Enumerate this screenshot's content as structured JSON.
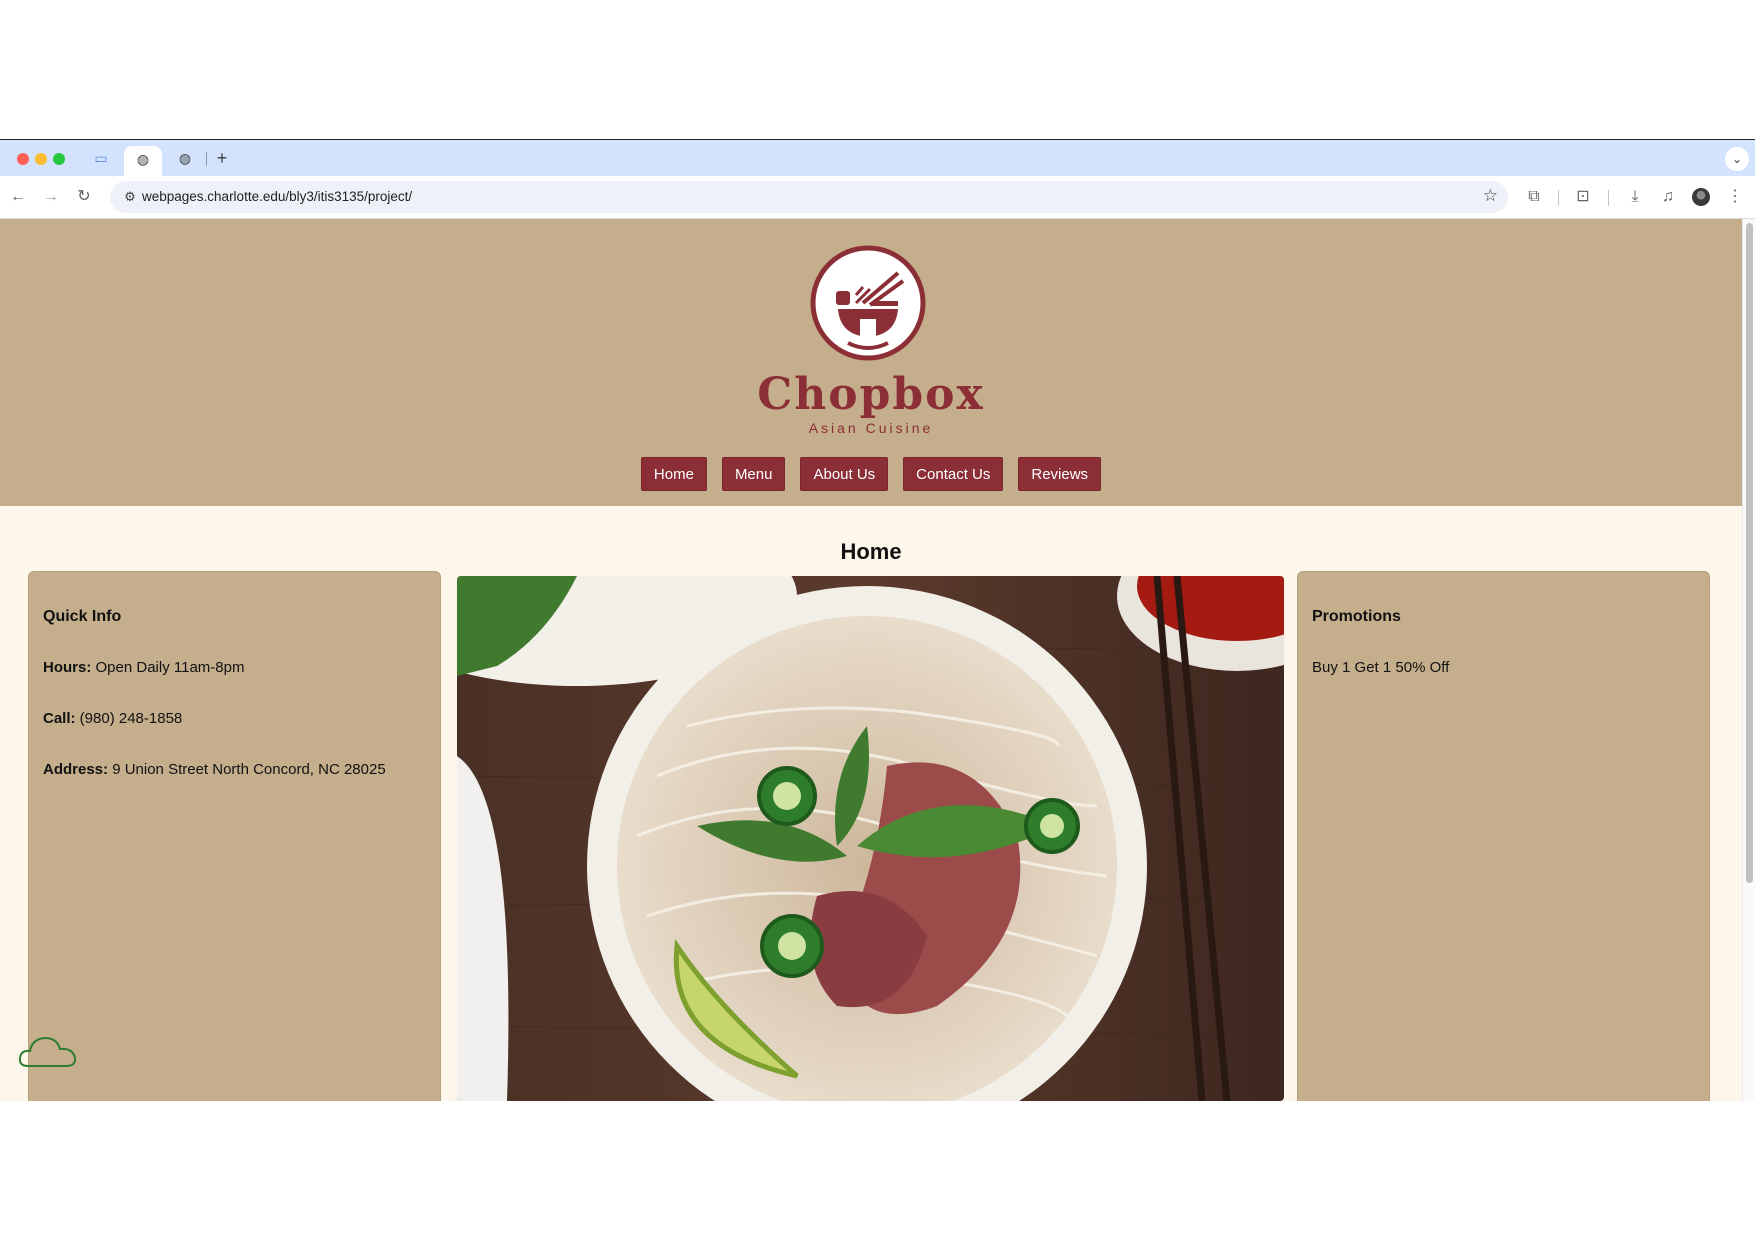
{
  "browser": {
    "url": "webpages.charlotte.edu/bly3/itis3135/project/",
    "new_tab": "+",
    "dropdown": "⌄"
  },
  "site": {
    "brand": "Chopbox",
    "tagline": "Asian Cuisine",
    "nav": [
      "Home",
      "Menu",
      "About Us",
      "Contact Us",
      "Reviews"
    ],
    "page_title": "Home"
  },
  "quick_info": {
    "heading": "Quick Info",
    "hours_label": "Hours:",
    "hours_value": " Open Daily 11am-8pm",
    "call_label": "Call:",
    "call_value": " (980) 248-1858",
    "address_label": "Address:",
    "address_value": " 9 Union Street North Concord, NC 28025"
  },
  "promotions": {
    "heading": "Promotions",
    "item": "Buy 1 Get 1 50% Off"
  },
  "colors": {
    "header_bg": "#c5ae8c",
    "brand_red": "#8b2e35",
    "page_bg": "#fcf7ea"
  }
}
